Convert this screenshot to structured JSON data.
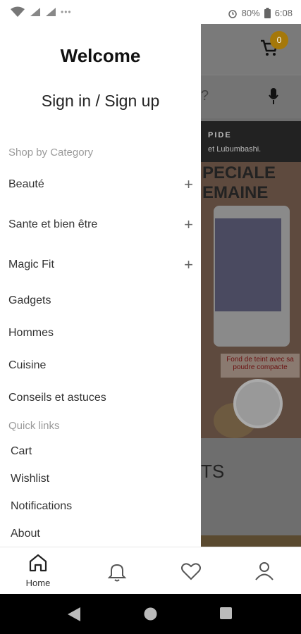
{
  "status_bar": {
    "battery": "80%",
    "time": "6:08",
    "icons": [
      "alarm-icon",
      "battery-icon",
      "wifi-icon",
      "signal-icon"
    ]
  },
  "background_app": {
    "cart_count": "0",
    "banner_lines": [
      "PIDE",
      "et Lubumbashi."
    ],
    "promo_lines": [
      "PECIALE",
      "EMAINE"
    ],
    "product_label": "Fond de teint avec sa poudre compacte",
    "partial_heading": "TS"
  },
  "drawer": {
    "welcome": "Welcome",
    "sign_in": "Sign in / Sign up",
    "shop_by_category": "Shop by Category",
    "categories": [
      {
        "label": "Beauté",
        "expandable": true
      },
      {
        "label": "Sante et bien être",
        "expandable": true
      },
      {
        "label": "Magic Fit",
        "expandable": true
      },
      {
        "label": "Gadgets",
        "expandable": false
      },
      {
        "label": "Hommes",
        "expandable": false
      },
      {
        "label": "Cuisine",
        "expandable": false
      },
      {
        "label": "Conseils et astuces",
        "expandable": false
      }
    ],
    "plus_symbol": "+",
    "quick_links_label": "Quick links",
    "quick_links": [
      "Cart",
      "Wishlist",
      "Notifications",
      "About"
    ]
  },
  "bottom_nav": {
    "home_label": "Home",
    "active_color": "#222222"
  },
  "colors": {
    "cart_badge": "#a5780a",
    "overlay": "#6e6e6e"
  }
}
